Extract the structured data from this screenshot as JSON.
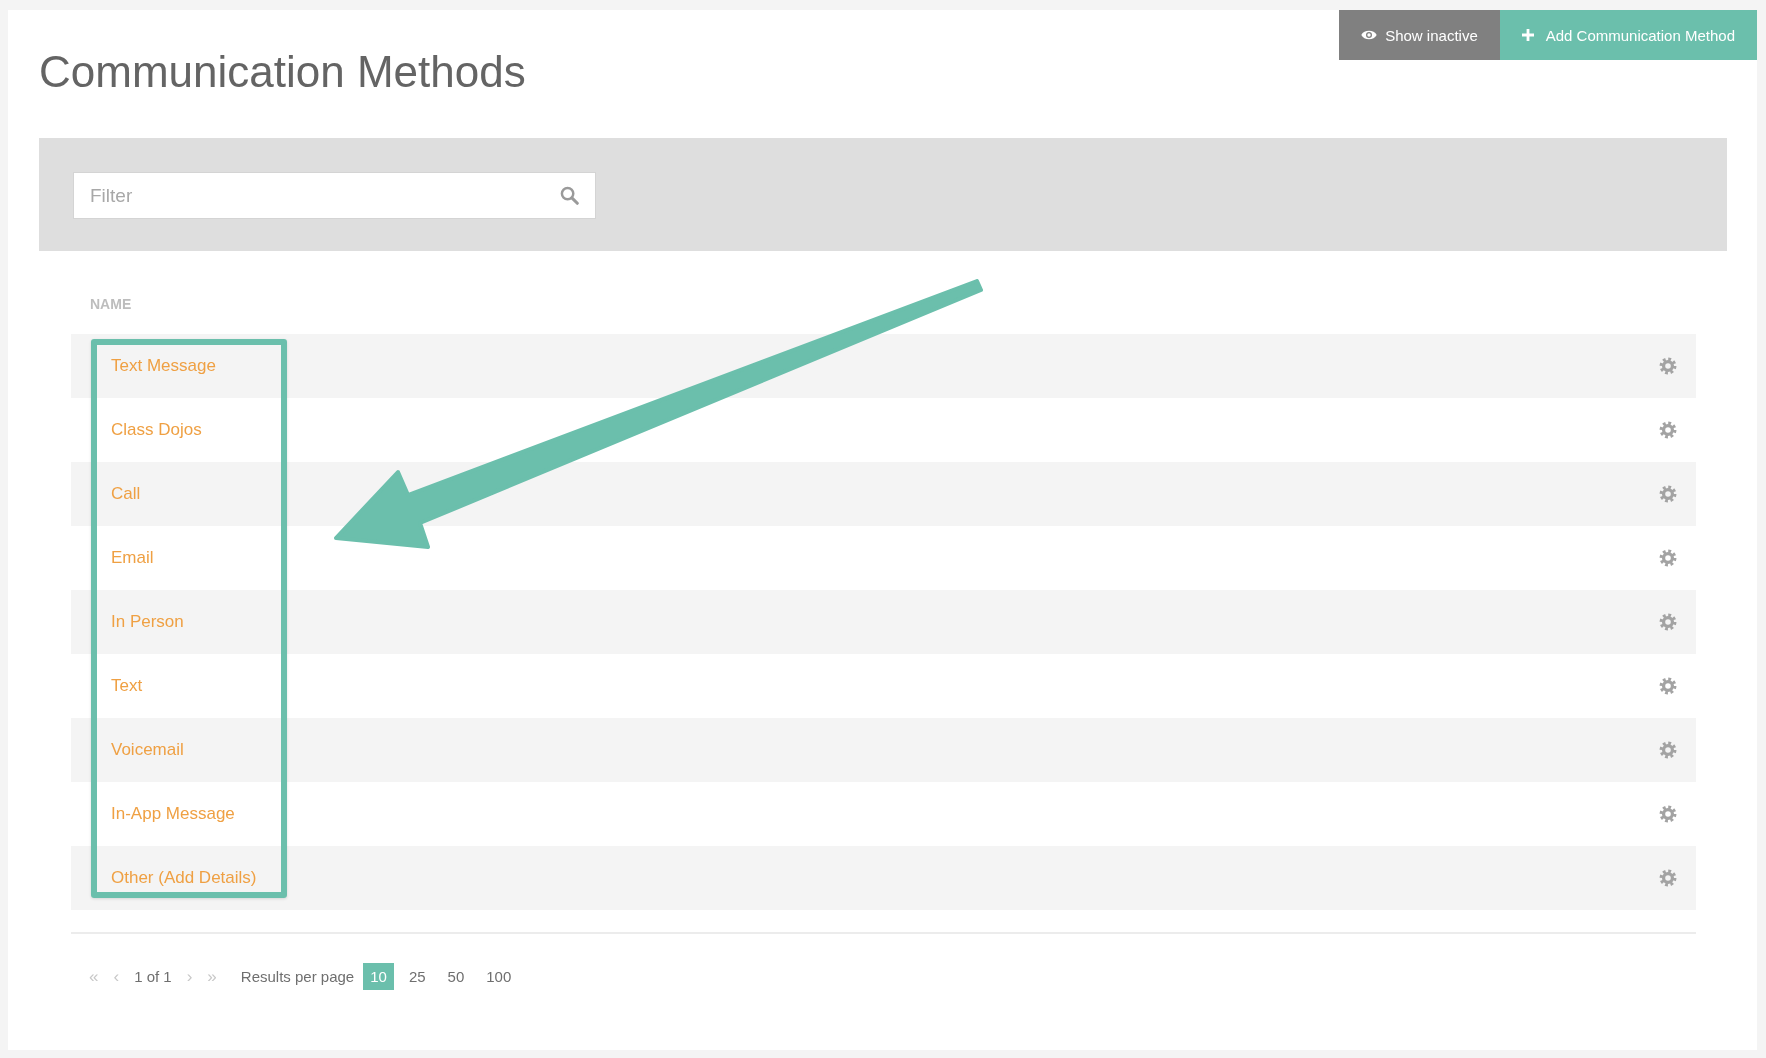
{
  "page": {
    "title": "Communication Methods"
  },
  "toolbar": {
    "buttons": [
      {
        "kind": "toggle",
        "label": "Show inactive"
      },
      {
        "kind": "add",
        "label": "Add Communication Method"
      }
    ]
  },
  "filter": {
    "placeholder": "Filter"
  },
  "table": {
    "columns": [
      "NAME"
    ],
    "rows": [
      {
        "name": "Text Message"
      },
      {
        "name": "Class Dojos"
      },
      {
        "name": "Call"
      },
      {
        "name": "Email"
      },
      {
        "name": "In Person"
      },
      {
        "name": "Text"
      },
      {
        "name": "Voicemail"
      },
      {
        "name": "In-App Message"
      },
      {
        "name": "Other (Add Details)"
      }
    ]
  },
  "pagination": {
    "controls": [
      {
        "kind": "first",
        "label": "«",
        "disabled": true
      },
      {
        "kind": "prev",
        "label": "‹",
        "disabled": true
      },
      {
        "kind": "info",
        "label": "1 of 1"
      },
      {
        "kind": "next",
        "label": "›",
        "disabled": true
      },
      {
        "kind": "last",
        "label": "»",
        "disabled": true
      }
    ],
    "results_label": "Results per page",
    "page_sizes": [
      {
        "label": "10",
        "selected": true
      },
      {
        "label": "25",
        "selected": false
      },
      {
        "label": "50",
        "selected": false
      },
      {
        "label": "100",
        "selected": false
      }
    ]
  }
}
